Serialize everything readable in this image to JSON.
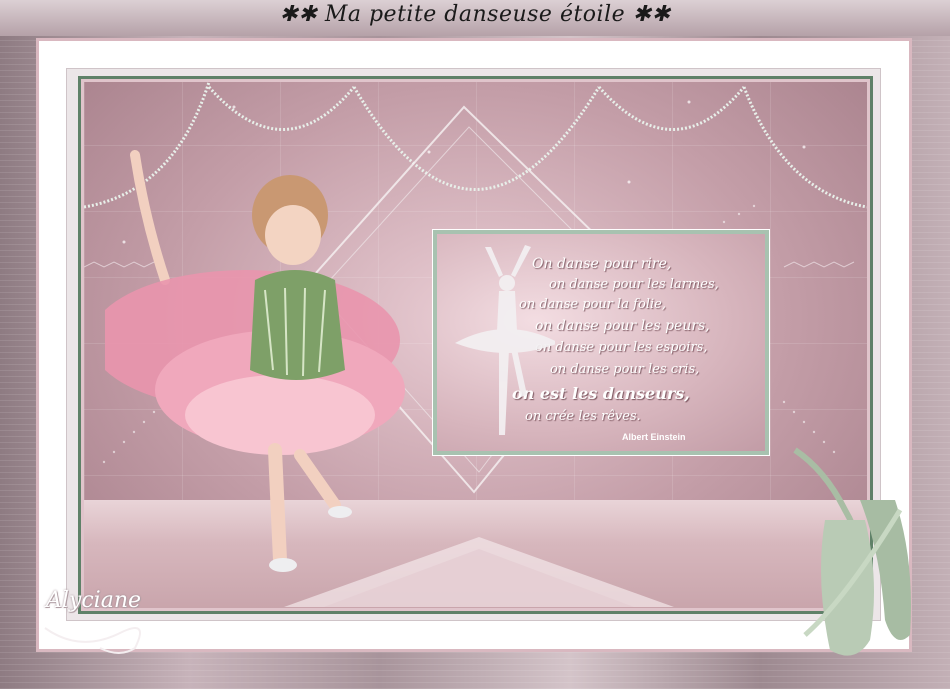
{
  "title": "✱✱ Ma petite danseuse étoile ✱✱",
  "quote": {
    "lines": [
      "On danse pour rire,",
      "on danse pour les larmes,",
      "on danse pour la folie,",
      "on danse pour les peurs,",
      "on danse pour les espoirs,",
      "on danse pour les cris,",
      "on est les danseurs,",
      "on crée les rêves."
    ],
    "author": "Albert Einstein"
  },
  "signature": "Alyciane",
  "colors": {
    "frame_green": "#5f8168",
    "pink": "#e0c4cb",
    "mauve": "#a67f8a",
    "card_border": "#a8c2b0"
  }
}
